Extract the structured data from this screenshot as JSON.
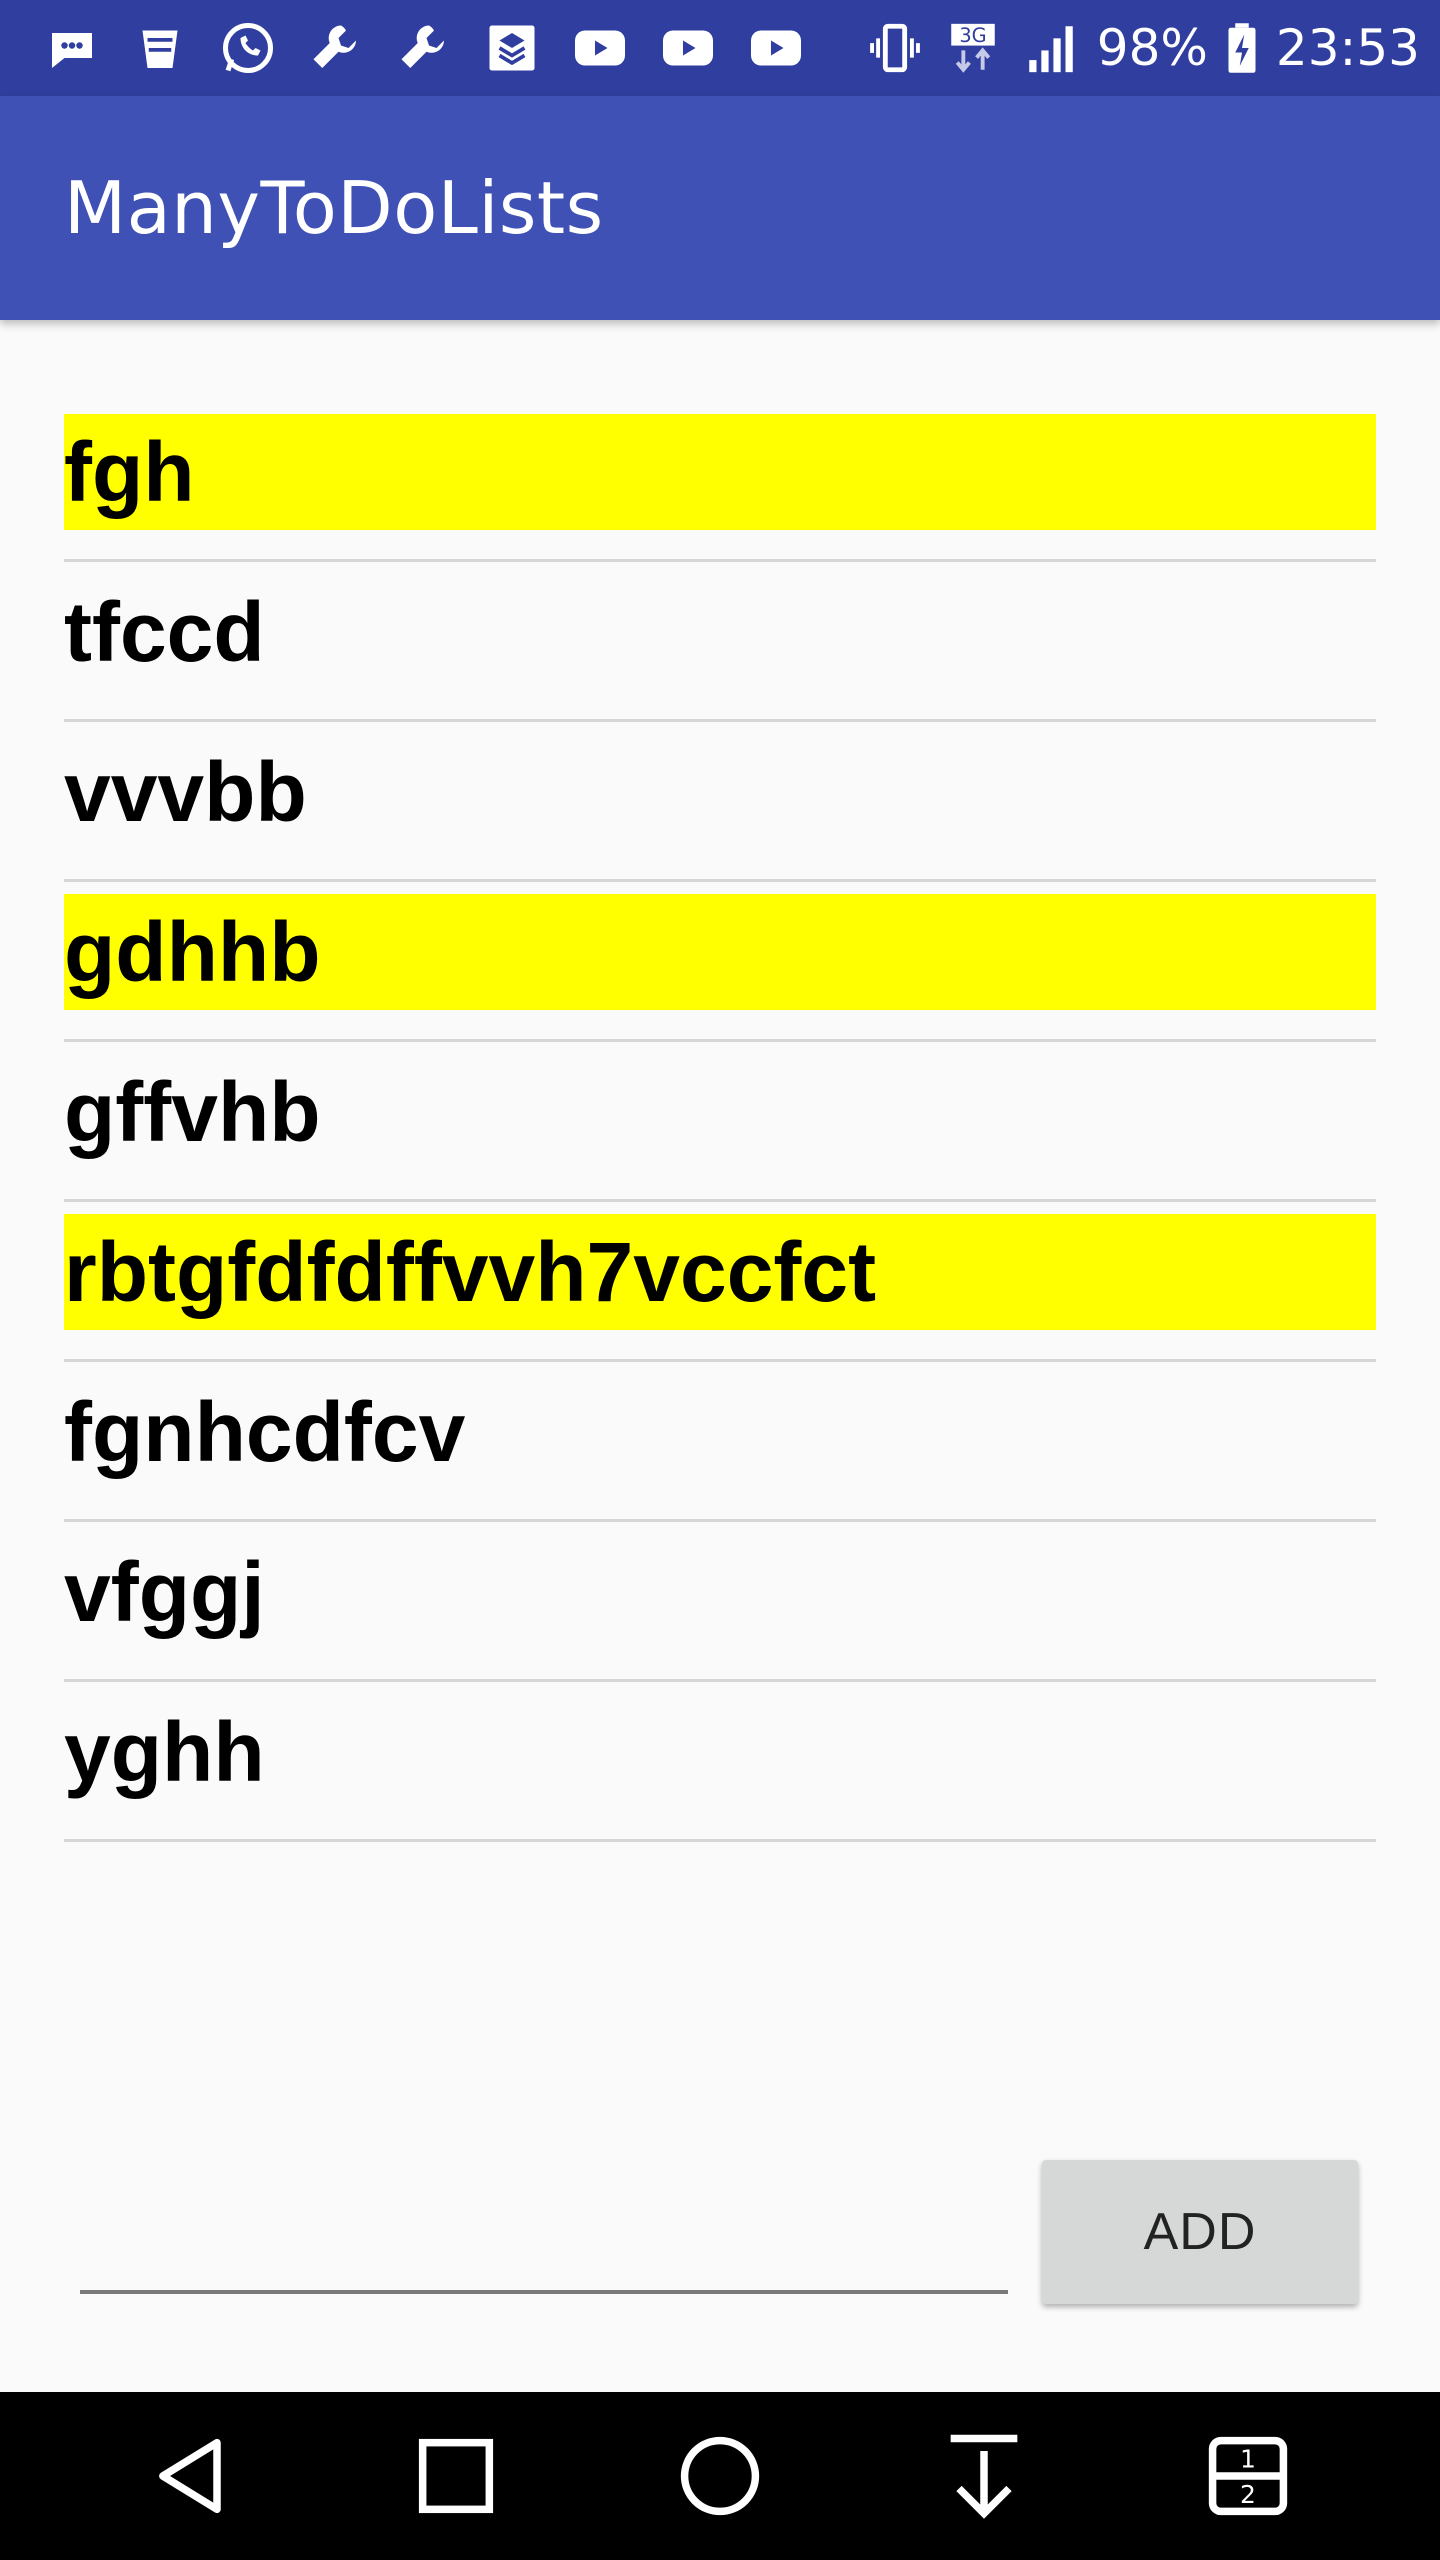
{
  "status_bar": {
    "battery": "98%",
    "time": "23:53",
    "network": "3G",
    "left_icons": [
      "message-icon",
      "trash-icon",
      "whatsapp-icon",
      "wrench-icon",
      "wrench-icon",
      "app-icon",
      "youtube-icon",
      "youtube-icon",
      "youtube-icon"
    ],
    "right_icons": [
      "vibrate-icon",
      "network-3g-icon",
      "signal-icon",
      "battery-charging-icon"
    ]
  },
  "app_bar": {
    "title": "ManyToDoLists",
    "background": "#3f51b5",
    "status_background": "#303f9f"
  },
  "todo_list": {
    "highlight_color": "#ffff00",
    "items": [
      {
        "text": "fgh",
        "highlighted": true
      },
      {
        "text": "tfccd",
        "highlighted": false
      },
      {
        "text": "vvvbb",
        "highlighted": false
      },
      {
        "text": "gdhhb",
        "highlighted": true
      },
      {
        "text": "gffvhb",
        "highlighted": false
      },
      {
        "text": "rbtgfdfdffvvh7vccfct",
        "highlighted": true
      },
      {
        "text": "fgnhcdfcv",
        "highlighted": false
      },
      {
        "text": "vfggj",
        "highlighted": false
      },
      {
        "text": "yghh",
        "highlighted": false
      }
    ]
  },
  "input": {
    "value": "",
    "placeholder": ""
  },
  "add_button": {
    "label": "ADD"
  },
  "nav_bar": {
    "icons": [
      "back-icon",
      "recents-icon",
      "home-icon",
      "notification-pull-icon",
      "dual-window-icon"
    ]
  }
}
